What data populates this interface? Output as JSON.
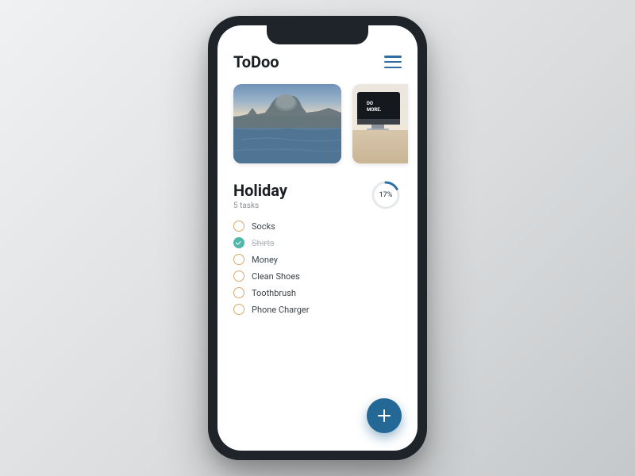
{
  "app": {
    "title": "ToDoo"
  },
  "colors": {
    "accent": "#246896",
    "hamburger": "#2f6ea3",
    "checkbox_border": "#d6a96b",
    "checkbox_done": "#4fb8a8",
    "progress_ring": "#2f6ea3"
  },
  "cards": [
    {
      "id": "holiday",
      "image": "venice-basilica-canal"
    },
    {
      "id": "work",
      "image": "desk-imac-do-more"
    }
  ],
  "list": {
    "title": "Holiday",
    "task_count_label": "5 tasks",
    "progress_percent": 17,
    "progress_label": "17%",
    "tasks": [
      {
        "label": "Socks",
        "done": false
      },
      {
        "label": "Shirts",
        "done": true
      },
      {
        "label": "Money",
        "done": false
      },
      {
        "label": "Clean Shoes",
        "done": false
      },
      {
        "label": "Toothbrush",
        "done": false
      },
      {
        "label": "Phone Charger",
        "done": false
      }
    ]
  },
  "monitor_text": {
    "line1": "DO",
    "line2": "MORE."
  },
  "icons": {
    "menu": "hamburger-icon",
    "add": "plus-icon"
  }
}
